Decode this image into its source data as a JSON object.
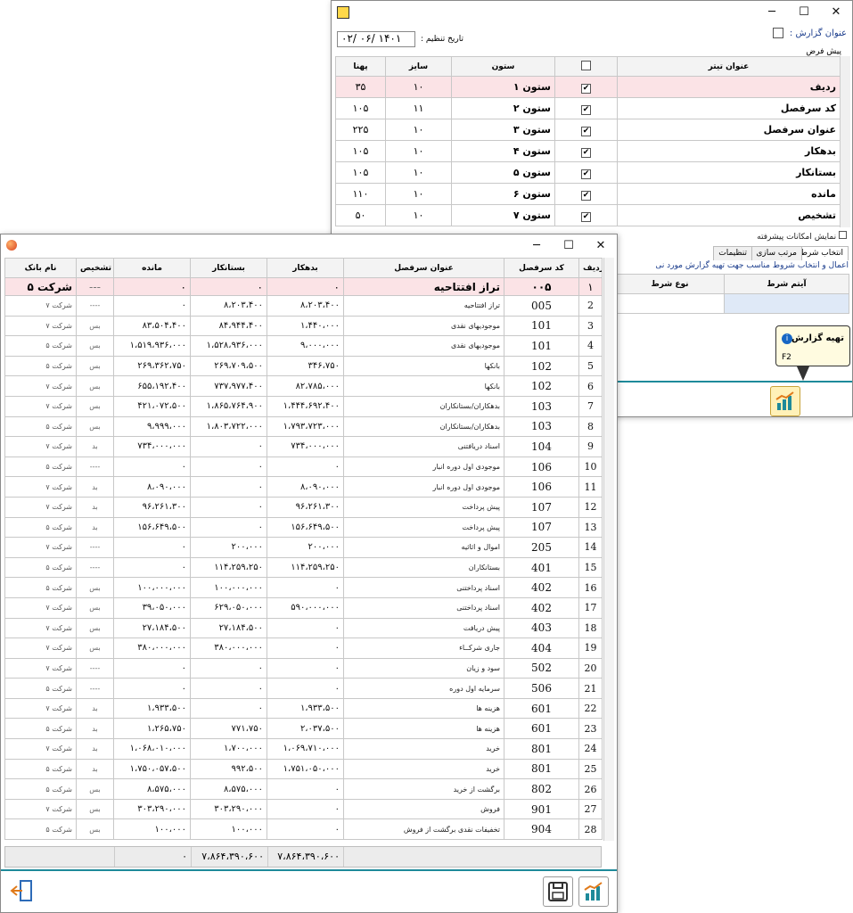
{
  "back_window": {
    "report_title_label": "عنوان گزارش :",
    "date_label": "تاریخ تنظیم :",
    "date_value": "۱۴۰۱ /۰۶ /۰۲",
    "preset_tab": "پیش فرض",
    "columns_headers": [
      "عنوان تیتر",
      "",
      "ستون",
      "سایز",
      "پهنا"
    ],
    "columns_rows": [
      {
        "title": "ردیف",
        "checked": true,
        "column": "ستون ۱",
        "size": "۱۰",
        "width": "۳۵"
      },
      {
        "title": "کد سرفصل",
        "checked": true,
        "column": "ستون ۲",
        "size": "۱۱",
        "width": "۱۰۵"
      },
      {
        "title": "عنوان سرفصل",
        "checked": true,
        "column": "ستون ۳",
        "size": "۱۰",
        "width": "۲۲۵"
      },
      {
        "title": "بدهکار",
        "checked": true,
        "column": "ستون ۴",
        "size": "۱۰",
        "width": "۱۰۵"
      },
      {
        "title": "بستانکار",
        "checked": true,
        "column": "ستون ۵",
        "size": "۱۰",
        "width": "۱۰۵"
      },
      {
        "title": "مانده",
        "checked": true,
        "column": "ستون ۶",
        "size": "۱۰",
        "width": "۱۱۰"
      },
      {
        "title": "تشخیص",
        "checked": true,
        "column": "ستون ۷",
        "size": "۱۰",
        "width": "۵۰"
      }
    ],
    "advanced_label": "نمایش امکانات پیشرفته",
    "tabs": [
      "انتخاب شرط",
      "مرتب سازی",
      "تنظیمات"
    ],
    "hint": "اعمال و انتخاب شروط مناسب جهت تهیه گزارش  مورد نی",
    "cond_headers": [
      "آیتم شرط",
      "نوع شرط"
    ],
    "tooltip_title": "تهیه گزارش",
    "tooltip_key": "F2"
  },
  "front_window": {
    "headers": [
      "ردیف",
      "کد سرفصل",
      "عنوان سرفصل",
      "بدهکار",
      "بستانکار",
      "مانده",
      "تشخیص",
      "نام بانک"
    ],
    "first_row": {
      "row": "۱",
      "code": "۰۰۵",
      "title": "تراز افتتاحیه",
      "debit": "۰",
      "credit": "۰",
      "balance": "۰",
      "status": "---",
      "bank": "شرکت ۵"
    },
    "rows": [
      {
        "row": "2",
        "code": "005",
        "title": "تراز افتتاحیه",
        "debit": "۸،۲۰۳،۴۰۰",
        "credit": "۸،۲۰۳،۴۰۰",
        "balance": "۰",
        "status": "----",
        "bank": "شرکت ۷"
      },
      {
        "row": "3",
        "code": "101",
        "title": "موجودیهای نقدی",
        "debit": "۱،۴۴۰،۰۰۰",
        "credit": "۸۴،۹۴۴،۴۰۰",
        "balance": "۸۳،۵۰۴،۴۰۰",
        "status": "بس",
        "bank": "شرکت ۷"
      },
      {
        "row": "4",
        "code": "101",
        "title": "موجودیهای نقدی",
        "debit": "۹،۰۰۰،۰۰۰",
        "credit": "۱،۵۲۸،۹۳۶،۰۰۰",
        "balance": "۱،۵۱۹،۹۳۶،۰۰۰",
        "status": "بس",
        "bank": "شرکت ۵"
      },
      {
        "row": "5",
        "code": "102",
        "title": "بانکها",
        "debit": "۳۴۶،۷۵۰",
        "credit": "۲۶۹،۷۰۹،۵۰۰",
        "balance": "۲۶۹،۳۶۲،۷۵۰",
        "status": "بس",
        "bank": "شرکت ۵"
      },
      {
        "row": "6",
        "code": "102",
        "title": "بانکها",
        "debit": "۸۲،۷۸۵،۰۰۰",
        "credit": "۷۳۷،۹۷۷،۴۰۰",
        "balance": "۶۵۵،۱۹۲،۴۰۰",
        "status": "بس",
        "bank": "شرکت ۷"
      },
      {
        "row": "7",
        "code": "103",
        "title": "بدهکاران/بستانکاران",
        "debit": "۱،۴۴۴،۶۹۲،۴۰۰",
        "credit": "۱،۸۶۵،۷۶۴،۹۰۰",
        "balance": "۴۲۱،۰۷۲،۵۰۰",
        "status": "بس",
        "bank": "شرکت ۷"
      },
      {
        "row": "8",
        "code": "103",
        "title": "بدهکاران/بستانکاران",
        "debit": "۱،۷۹۳،۷۲۳،۰۰۰",
        "credit": "۱،۸۰۳،۷۲۲،۰۰۰",
        "balance": "۹،۹۹۹،۰۰۰",
        "status": "بس",
        "bank": "شرکت ۵"
      },
      {
        "row": "9",
        "code": "104",
        "title": "اسناد دریافتنی",
        "debit": "۷۳۴،۰۰۰،۰۰۰",
        "credit": "۰",
        "balance": "۷۳۴،۰۰۰،۰۰۰",
        "status": "بد",
        "bank": "شرکت ۷"
      },
      {
        "row": "10",
        "code": "106",
        "title": "موجودی اول دوره انبار",
        "debit": "۰",
        "credit": "۰",
        "balance": "۰",
        "status": "----",
        "bank": "شرکت ۵"
      },
      {
        "row": "11",
        "code": "106",
        "title": "موجودی اول دوره انبار",
        "debit": "۸،۰۹۰،۰۰۰",
        "credit": "۰",
        "balance": "۸،۰۹۰،۰۰۰",
        "status": "بد",
        "bank": "شرکت ۷"
      },
      {
        "row": "12",
        "code": "107",
        "title": "پیش پرداخت",
        "debit": "۹۶،۲۶۱،۳۰۰",
        "credit": "۰",
        "balance": "۹۶،۲۶۱،۳۰۰",
        "status": "بد",
        "bank": "شرکت ۷"
      },
      {
        "row": "13",
        "code": "107",
        "title": "پیش پرداخت",
        "debit": "۱۵۶،۶۴۹،۵۰۰",
        "credit": "۰",
        "balance": "۱۵۶،۶۴۹،۵۰۰",
        "status": "بد",
        "bank": "شرکت ۵"
      },
      {
        "row": "14",
        "code": "205",
        "title": "اموال و اثاثیه",
        "debit": "۲۰۰،۰۰۰",
        "credit": "۲۰۰،۰۰۰",
        "balance": "۰",
        "status": "----",
        "bank": "شرکت ۷"
      },
      {
        "row": "15",
        "code": "401",
        "title": "بستانکاران",
        "debit": "۱۱۴،۲۵۹،۲۵۰",
        "credit": "۱۱۴،۲۵۹،۲۵۰",
        "balance": "۰",
        "status": "----",
        "bank": "شرکت ۵"
      },
      {
        "row": "16",
        "code": "402",
        "title": "اسناد پرداختنی",
        "debit": "۰",
        "credit": "۱۰۰،۰۰۰،۰۰۰",
        "balance": "۱۰۰،۰۰۰،۰۰۰",
        "status": "بس",
        "bank": "شرکت ۵"
      },
      {
        "row": "17",
        "code": "402",
        "title": "اسناد پرداختنی",
        "debit": "۵۹۰،۰۰۰،۰۰۰",
        "credit": "۶۲۹،۰۵۰،۰۰۰",
        "balance": "۳۹،۰۵۰،۰۰۰",
        "status": "بس",
        "bank": "شرکت ۷"
      },
      {
        "row": "18",
        "code": "403",
        "title": "پیش دریافت",
        "debit": "۰",
        "credit": "۲۷،۱۸۴،۵۰۰",
        "balance": "۲۷،۱۸۴،۵۰۰",
        "status": "بس",
        "bank": "شرکت ۷"
      },
      {
        "row": "19",
        "code": "404",
        "title": "جاری شرکــاء",
        "debit": "۰",
        "credit": "۳۸۰،۰۰۰،۰۰۰",
        "balance": "۳۸۰،۰۰۰،۰۰۰",
        "status": "بس",
        "bank": "شرکت ۷"
      },
      {
        "row": "20",
        "code": "502",
        "title": "سود و زیان",
        "debit": "۰",
        "credit": "۰",
        "balance": "۰",
        "status": "----",
        "bank": "شرکت ۷"
      },
      {
        "row": "21",
        "code": "506",
        "title": "سرمایه اول دوره",
        "debit": "۰",
        "credit": "۰",
        "balance": "۰",
        "status": "----",
        "bank": "شرکت ۵"
      },
      {
        "row": "22",
        "code": "601",
        "title": "هزینه ها",
        "debit": "۱،۹۳۳،۵۰۰",
        "credit": "۰",
        "balance": "۱،۹۳۳،۵۰۰",
        "status": "بد",
        "bank": "شرکت ۷"
      },
      {
        "row": "23",
        "code": "601",
        "title": "هزینه ها",
        "debit": "۲،۰۳۷،۵۰۰",
        "credit": "۷۷۱،۷۵۰",
        "balance": "۱،۲۶۵،۷۵۰",
        "status": "بد",
        "bank": "شرکت ۵"
      },
      {
        "row": "24",
        "code": "801",
        "title": "خرید",
        "debit": "۱،۰۶۹،۷۱۰،۰۰۰",
        "credit": "۱،۷۰۰،۰۰۰",
        "balance": "۱،۰۶۸،۰۱۰،۰۰۰",
        "status": "بد",
        "bank": "شرکت ۷"
      },
      {
        "row": "25",
        "code": "801",
        "title": "خرید",
        "debit": "۱،۷۵۱،۰۵۰،۰۰۰",
        "credit": "۹۹۲،۵۰۰",
        "balance": "۱،۷۵۰،۰۵۷،۵۰۰",
        "status": "بد",
        "bank": "شرکت ۵"
      },
      {
        "row": "26",
        "code": "802",
        "title": "برگشت از خرید",
        "debit": "۰",
        "credit": "۸،۵۷۵،۰۰۰",
        "balance": "۸،۵۷۵،۰۰۰",
        "status": "بس",
        "bank": "شرکت ۵"
      },
      {
        "row": "27",
        "code": "901",
        "title": "فروش",
        "debit": "۰",
        "credit": "۳۰۳،۲۹۰،۰۰۰",
        "balance": "۳۰۳،۲۹۰،۰۰۰",
        "status": "بس",
        "bank": "شرکت ۷"
      },
      {
        "row": "28",
        "code": "904",
        "title": "تخفیفات نقدی برگشت از فروش",
        "debit": "۰",
        "credit": "۱۰۰،۰۰۰",
        "balance": "۱۰۰،۰۰۰",
        "status": "بس",
        "bank": "شرکت ۵"
      }
    ],
    "totals": {
      "debit": "۷،۸۶۴،۳۹۰،۶۰۰",
      "credit": "۷،۸۶۴،۳۹۰،۶۰۰",
      "balance": "۰"
    }
  },
  "colors": {
    "highlight_row": "#fbe3e6",
    "accent": "#1e8a9a",
    "tooltip_bg": "#fffbe0"
  }
}
